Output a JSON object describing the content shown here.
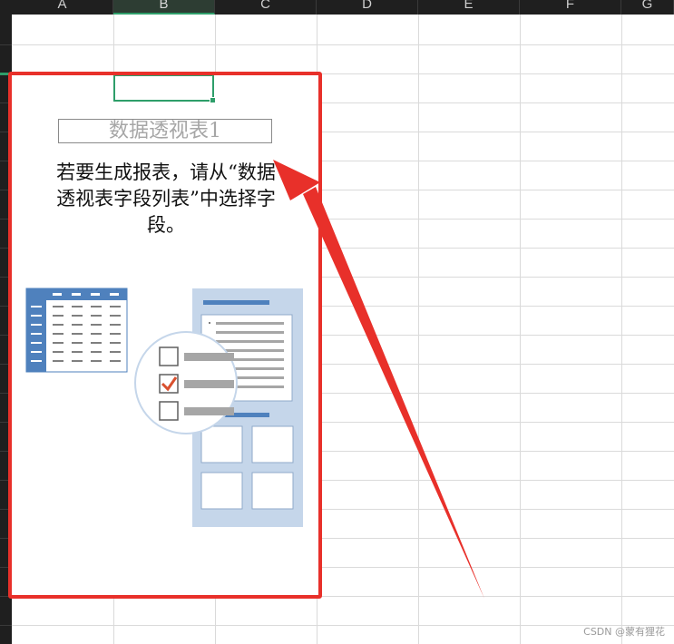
{
  "columns": [
    "A",
    "B",
    "C",
    "D",
    "E",
    "F",
    "G"
  ],
  "active_column": "B",
  "pivot": {
    "title": "数据透视表1",
    "message_line1": "若要生成报表，请从“数据",
    "message_line2": "透视表字段列表”中选择字",
    "message_line3": "段。"
  },
  "watermark": "CSDN @蒙有狸花",
  "colors": {
    "accent": "#2e9e6a",
    "highlight": "#e8302a",
    "illustration_blue": "#4f81bd",
    "illustration_light": "#c5d6ea"
  },
  "icons": {
    "field_list": "field-list-icon",
    "checklist": "checklist-icon",
    "pivot_layout": "pivot-layout-icon"
  }
}
